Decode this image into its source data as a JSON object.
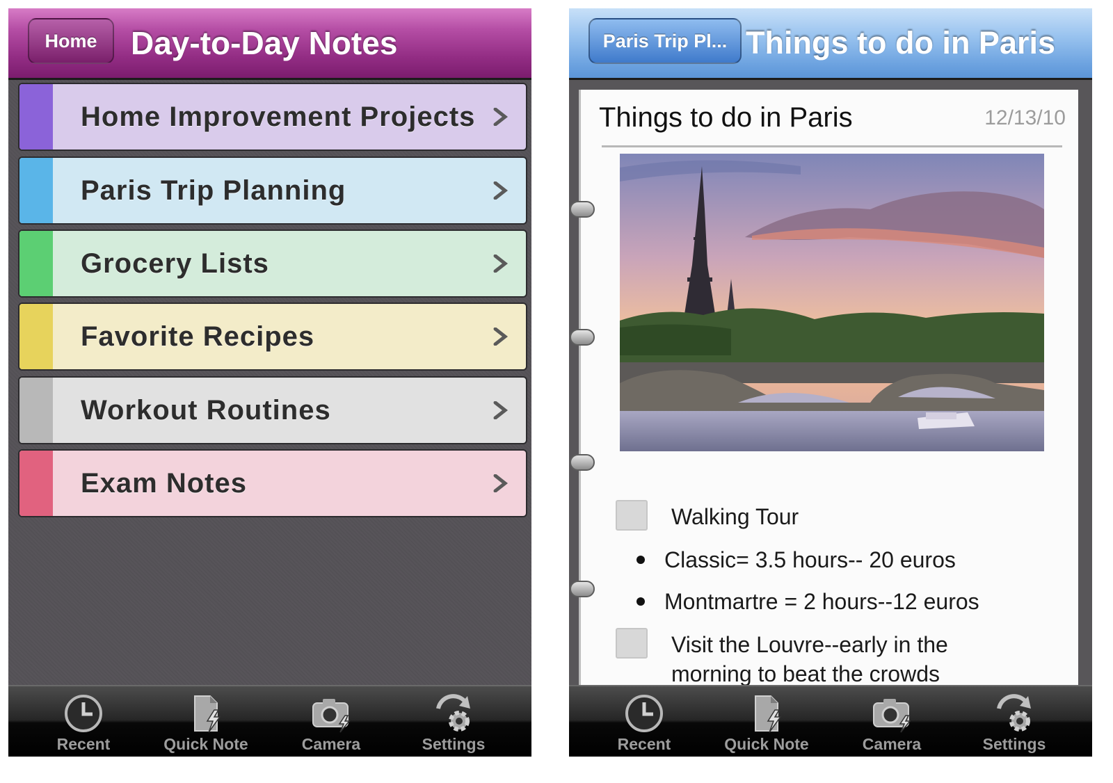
{
  "left_screen": {
    "nav": {
      "back_label": "Home",
      "title": "Day-to-Day Notes",
      "bar_color": "#9a3389"
    },
    "sections": [
      {
        "label": "Home Improvement Projects",
        "tab_color": "#8b63d9",
        "row_color": "#d9cbeb"
      },
      {
        "label": "Paris Trip Planning",
        "tab_color": "#5ab5e8",
        "row_color": "#d1e8f3"
      },
      {
        "label": "Grocery Lists",
        "tab_color": "#5ccf73",
        "row_color": "#d4ecdb"
      },
      {
        "label": "Favorite Recipes",
        "tab_color": "#e7d35c",
        "row_color": "#f3ecc9"
      },
      {
        "label": "Workout Routines",
        "tab_color": "#b8b8b8",
        "row_color": "#e1e1e1"
      },
      {
        "label": "Exam Notes",
        "tab_color": "#e1627f",
        "row_color": "#f3d3dc"
      }
    ]
  },
  "right_screen": {
    "nav": {
      "back_label": "Paris Trip Pl...",
      "title": "Things to do in Paris",
      "bar_color": "#6da3e0"
    },
    "note": {
      "title": "Things to do in Paris",
      "date": "12/13/10",
      "items": [
        {
          "type": "checkbox",
          "text": "Walking Tour",
          "checked": false
        },
        {
          "type": "bullet",
          "text": "Classic= 3.5 hours-- 20 euros"
        },
        {
          "type": "bullet",
          "text": "Montmartre = 2 hours--12 euros"
        },
        {
          "type": "checkbox",
          "line1": "Visit the Louvre--early in the",
          "line2": "morning to beat the crowds",
          "checked": false
        }
      ]
    }
  },
  "tabbar": {
    "tabs": [
      {
        "label": "Recent",
        "icon": "clock-icon"
      },
      {
        "label": "Quick Note",
        "icon": "quick-note-icon"
      },
      {
        "label": "Camera",
        "icon": "camera-icon"
      },
      {
        "label": "Settings",
        "icon": "settings-icon"
      }
    ]
  }
}
